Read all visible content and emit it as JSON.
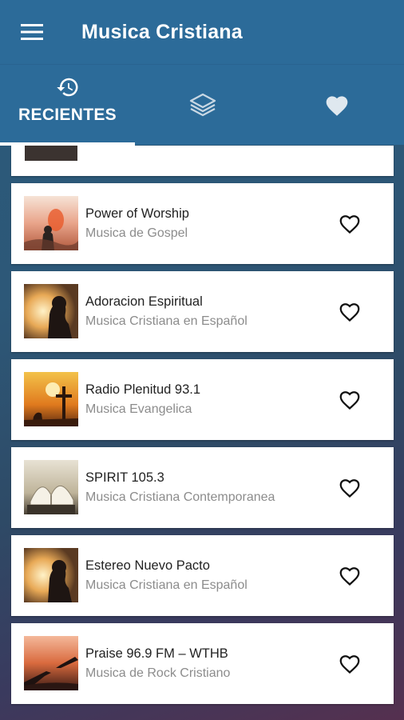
{
  "app": {
    "title": "Musica Cristiana"
  },
  "tabs": {
    "recent_label": "RECIENTES"
  },
  "stations": [
    {
      "name": "Power of Worship",
      "genre": "Musica de Gospel"
    },
    {
      "name": "Adoracion Espiritual",
      "genre": "Musica Cristiana en Español"
    },
    {
      "name": "Radio Plenitud 93.1",
      "genre": "Musica Evangelica"
    },
    {
      "name": "SPIRIT 105.3",
      "genre": "Musica Cristiana Contemporanea"
    },
    {
      "name": "Estereo Nuevo Pacto",
      "genre": "Musica Cristiana en Español"
    },
    {
      "name": "Praise 96.9 FM – WTHB",
      "genre": "Musica de Rock Cristiano"
    }
  ],
  "colors": {
    "primary": "#2c6b99",
    "accent": "#ffffff"
  },
  "icons": {
    "menu": "menu-icon",
    "recent": "history-icon",
    "layers": "layers-icon",
    "favorites": "heart-icon",
    "favorite_toggle": "heart-outline-icon"
  }
}
